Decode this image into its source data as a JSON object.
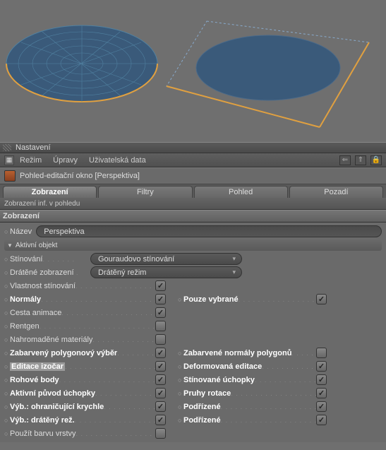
{
  "panel": {
    "title": "Nastavení"
  },
  "menubar": {
    "items": [
      "Režim",
      "Úpravy",
      "Uživatelská data"
    ]
  },
  "file": {
    "label": "Pohled-editační okno [Perspektiva]"
  },
  "tabs": {
    "items": [
      "Zobrazení",
      "Filtry",
      "Pohled",
      "Pozadí"
    ],
    "active": 0
  },
  "subbar": {
    "label": "Zobrazení inf. v pohledu"
  },
  "section": {
    "title": "Zobrazení"
  },
  "name_row": {
    "label": "Název",
    "value": "Perspektiva"
  },
  "active_obj": {
    "header": "Aktivní objekt"
  },
  "shading": {
    "label": "Stínování",
    "value": "Gouraudovo stínování"
  },
  "wire": {
    "label": "Drátěné zobrazení",
    "value": "Drátěný režim"
  },
  "left": [
    {
      "label": "Vlastnost stínování",
      "bold": false,
      "checked": true
    },
    {
      "label": "Normály",
      "bold": true,
      "checked": true
    },
    {
      "label": "Cesta animace",
      "bold": false,
      "checked": true
    },
    {
      "label": "Rentgen",
      "bold": false,
      "checked": false
    },
    {
      "label": "Nahromaděné materiály",
      "bold": false,
      "checked": false
    },
    {
      "label": "Zabarvený polygonový výběr",
      "bold": true,
      "checked": true
    },
    {
      "label": "Editace izočar",
      "bold": true,
      "checked": true,
      "hl": true
    },
    {
      "label": "Rohové body",
      "bold": true,
      "checked": true
    },
    {
      "label": "Aktivní původ úchopky",
      "bold": true,
      "checked": true
    },
    {
      "label": "Výb.: ohraničující krychle",
      "bold": true,
      "checked": true
    },
    {
      "label": "Výb.: drátěný rež.",
      "bold": true,
      "checked": true
    },
    {
      "label": "Použít barvu vrstvy",
      "bold": false,
      "checked": false
    }
  ],
  "right": [
    {
      "label": "Pouze vybrané",
      "bold": true,
      "checked": true,
      "spacer_before": 0
    },
    {
      "label": "Zabarvené normály polygonů",
      "bold": true,
      "checked": false,
      "spacer_before": 3
    },
    {
      "label": "Deformovaná editace",
      "bold": true,
      "checked": true,
      "spacer_before": 0
    },
    {
      "label": "Stínované úchopky",
      "bold": true,
      "checked": true,
      "spacer_before": 0
    },
    {
      "label": "Pruhy rotace",
      "bold": true,
      "checked": true,
      "spacer_before": 0
    },
    {
      "label": "Podřízené",
      "bold": true,
      "checked": true,
      "spacer_before": 0
    },
    {
      "label": "Podřízené",
      "bold": true,
      "checked": true,
      "spacer_before": 0
    }
  ]
}
